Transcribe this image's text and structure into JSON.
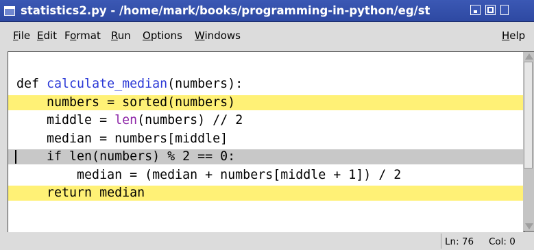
{
  "window": {
    "title": "statistics2.py - /home/mark/books/programming-in-python/eg/st"
  },
  "menu": {
    "file": {
      "prefix": "",
      "mnemonic": "F",
      "rest": "ile"
    },
    "edit": {
      "prefix": "",
      "mnemonic": "E",
      "rest": "dit"
    },
    "format": {
      "prefix": "F",
      "mnemonic": "o",
      "rest": "rmat"
    },
    "run": {
      "prefix": "",
      "mnemonic": "R",
      "rest": "un"
    },
    "options": {
      "prefix": "",
      "mnemonic": "O",
      "rest": "ptions"
    },
    "windows": {
      "prefix": "",
      "mnemonic": "W",
      "rest": "indows"
    },
    "help": {
      "prefix": "",
      "mnemonic": "H",
      "rest": "elp"
    }
  },
  "code": {
    "lines": [
      {
        "highlight": "none",
        "parts": [
          {
            "text": "def ",
            "role": "keyword"
          },
          {
            "text": "calculate_median",
            "role": "function-name"
          },
          {
            "text": "(numbers):",
            "role": "plain"
          }
        ]
      },
      {
        "highlight": "yellow",
        "parts": [
          {
            "text": "    numbers = sorted(numbers)",
            "role": "plain"
          }
        ]
      },
      {
        "highlight": "none",
        "parts": [
          {
            "text": "    middle = ",
            "role": "plain"
          },
          {
            "text": "len",
            "role": "builtin"
          },
          {
            "text": "(numbers) // 2",
            "role": "plain"
          }
        ]
      },
      {
        "highlight": "none",
        "parts": [
          {
            "text": "    median = numbers[middle]",
            "role": "plain"
          }
        ]
      },
      {
        "highlight": "gray",
        "parts": [
          {
            "text": "    if len(numbers) % 2 == 0:",
            "role": "plain"
          }
        ]
      },
      {
        "highlight": "none",
        "parts": [
          {
            "text": "        median = (median + numbers[middle + 1]) / 2",
            "role": "plain"
          }
        ]
      },
      {
        "highlight": "yellow",
        "parts": [
          {
            "text": "    return median",
            "role": "plain"
          }
        ]
      }
    ],
    "colors": {
      "function_name": "#2a38d6",
      "builtin": "#8e27a8",
      "highlight_yellow": "#fff176",
      "highlight_gray": "#c8c8c8"
    }
  },
  "status": {
    "line": "Ln: 76",
    "col": "Col: 0"
  },
  "icons": {
    "window_menu": "window-menu-icon",
    "minimize": "minimize-icon",
    "maximize": "maximize-icon",
    "close": "close-icon"
  }
}
